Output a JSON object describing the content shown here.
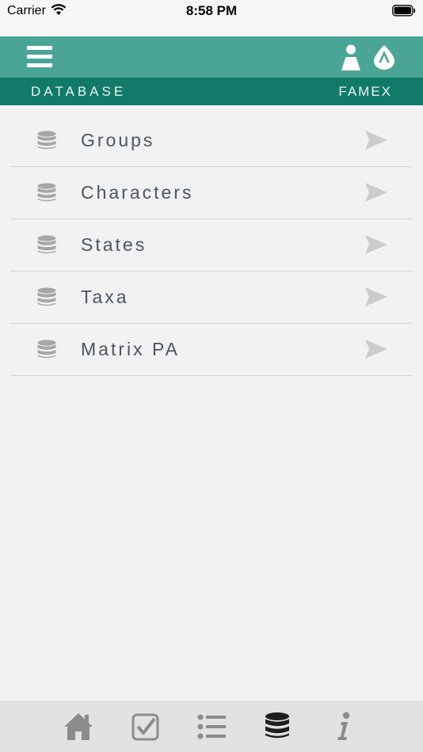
{
  "status_bar": {
    "carrier": "Carrier",
    "time": "8:58 PM"
  },
  "header": {
    "menu_icon": "hamburger-menu-icon",
    "right_icons": [
      "person-icon",
      "app-logo-icon"
    ],
    "section_title": "DATABASE",
    "app_name": "FAMEX"
  },
  "list": {
    "items": [
      {
        "label": "Groups",
        "icon": "database-icon"
      },
      {
        "label": "Characters",
        "icon": "database-icon"
      },
      {
        "label": "States",
        "icon": "database-icon"
      },
      {
        "label": "Taxa",
        "icon": "database-icon"
      },
      {
        "label": "Matrix PA",
        "icon": "database-icon"
      }
    ]
  },
  "tab_bar": {
    "tabs": [
      {
        "icon": "home-icon",
        "active": false
      },
      {
        "icon": "checkbox-icon",
        "active": false
      },
      {
        "icon": "list-icon",
        "active": false
      },
      {
        "icon": "database-icon",
        "active": true
      },
      {
        "icon": "info-icon",
        "active": false
      }
    ]
  },
  "colors": {
    "nav_bar": "#4aa596",
    "sub_header": "#117a68",
    "background": "#f2f2f2",
    "tab_bar": "#e2e2e2",
    "list_text": "#4a5563",
    "tab_inactive": "#8c8c8c",
    "tab_active": "#1e1e1e"
  }
}
